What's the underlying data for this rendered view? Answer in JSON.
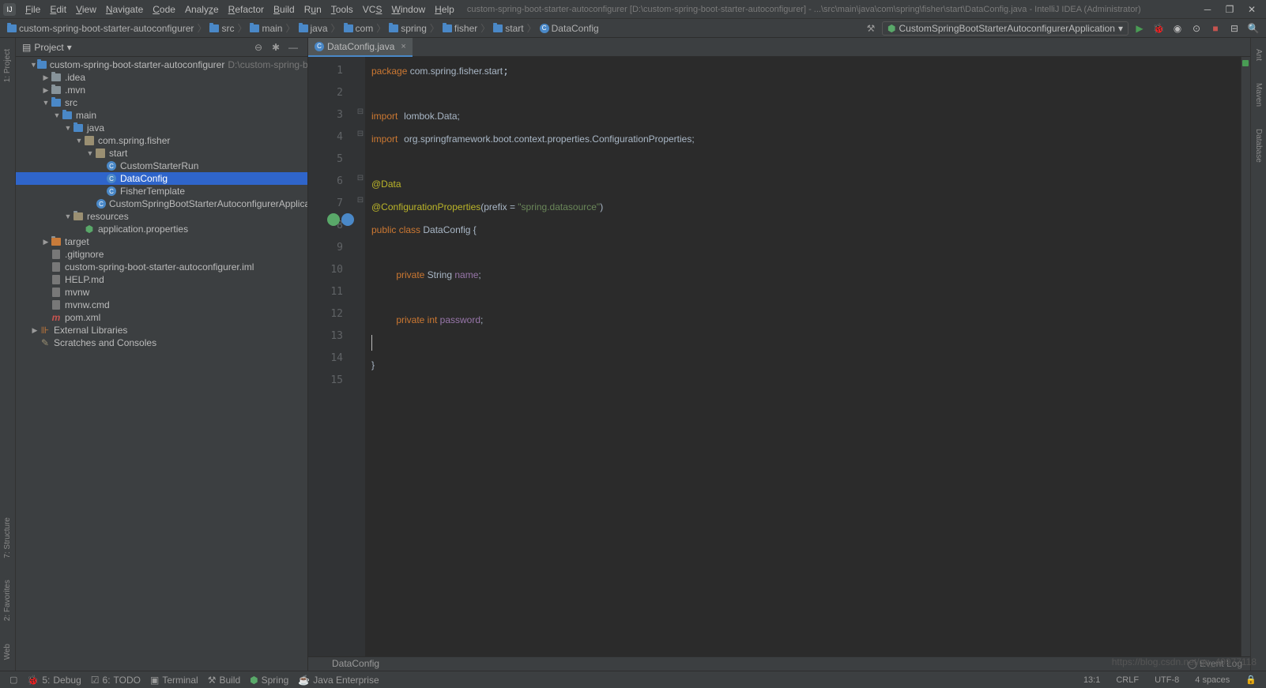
{
  "window": {
    "title": "custom-spring-boot-starter-autoconfigurer [D:\\custom-spring-boot-starter-autoconfigurer] - ...\\src\\main\\java\\com\\spring\\fisher\\start\\DataConfig.java - IntelliJ IDEA (Administrator)"
  },
  "menu": [
    "File",
    "Edit",
    "View",
    "Navigate",
    "Code",
    "Analyze",
    "Refactor",
    "Build",
    "Run",
    "Tools",
    "VCS",
    "Window",
    "Help"
  ],
  "breadcrumbs": [
    "custom-spring-boot-starter-autoconfigurer",
    "src",
    "main",
    "java",
    "com",
    "spring",
    "fisher",
    "start",
    "DataConfig"
  ],
  "run_config": {
    "selected": "CustomSpringBootStarterAutoconfigurerApplication"
  },
  "project_panel": {
    "title": "Project"
  },
  "tree": {
    "root": {
      "label": "custom-spring-boot-starter-autoconfigurer",
      "suffix": "D:\\custom-spring-boot-starte"
    },
    "items": [
      {
        "depth": 1,
        "arrow": "open",
        "icon": "module",
        "label": "custom-spring-boot-starter-autoconfigurer",
        "suffix": "D:\\custom-spring-boot-starte"
      },
      {
        "depth": 2,
        "arrow": "closed",
        "icon": "folder",
        "label": ".idea"
      },
      {
        "depth": 2,
        "arrow": "closed",
        "icon": "folder",
        "label": ".mvn"
      },
      {
        "depth": 2,
        "arrow": "open",
        "icon": "folder-blue",
        "label": "src"
      },
      {
        "depth": 3,
        "arrow": "open",
        "icon": "folder-blue",
        "label": "main"
      },
      {
        "depth": 4,
        "arrow": "open",
        "icon": "folder-blue",
        "label": "java"
      },
      {
        "depth": 5,
        "arrow": "open",
        "icon": "package",
        "label": "com.spring.fisher"
      },
      {
        "depth": 6,
        "arrow": "open",
        "icon": "package",
        "label": "start"
      },
      {
        "depth": 7,
        "arrow": "leaf",
        "icon": "class",
        "label": "CustomStarterRun"
      },
      {
        "depth": 7,
        "arrow": "leaf",
        "icon": "class",
        "label": "DataConfig",
        "selected": true
      },
      {
        "depth": 7,
        "arrow": "leaf",
        "icon": "class",
        "label": "FisherTemplate"
      },
      {
        "depth": 7,
        "arrow": "leaf",
        "icon": "class-run",
        "label": "CustomSpringBootStarterAutoconfigurerApplication"
      },
      {
        "depth": 4,
        "arrow": "open",
        "icon": "resources",
        "label": "resources"
      },
      {
        "depth": 5,
        "arrow": "leaf",
        "icon": "props",
        "label": "application.properties"
      },
      {
        "depth": 2,
        "arrow": "closed",
        "icon": "folder-orange",
        "label": "target"
      },
      {
        "depth": 2,
        "arrow": "leaf",
        "icon": "file",
        "label": ".gitignore"
      },
      {
        "depth": 2,
        "arrow": "leaf",
        "icon": "file",
        "label": "custom-spring-boot-starter-autoconfigurer.iml"
      },
      {
        "depth": 2,
        "arrow": "leaf",
        "icon": "file",
        "label": "HELP.md"
      },
      {
        "depth": 2,
        "arrow": "leaf",
        "icon": "file",
        "label": "mvnw"
      },
      {
        "depth": 2,
        "arrow": "leaf",
        "icon": "file",
        "label": "mvnw.cmd"
      },
      {
        "depth": 2,
        "arrow": "leaf",
        "icon": "maven",
        "label": "pom.xml"
      },
      {
        "depth": 1,
        "arrow": "closed",
        "icon": "lib",
        "label": "External Libraries"
      },
      {
        "depth": 1,
        "arrow": "leaf",
        "icon": "scratch",
        "label": "Scratches and Consoles"
      }
    ]
  },
  "tab": {
    "label": "DataConfig.java"
  },
  "code": {
    "l1": "package com.spring.fisher.start;",
    "l3a": "import",
    "l3b": "lombok.Data;",
    "l4a": "import",
    "l4b": "org.springframework.boot.context.properties.ConfigurationProperties;",
    "l6": "@Data",
    "l7a": "@ConfigurationProperties",
    "l7b": "(prefix = ",
    "l7c": "\"spring.datasource\"",
    "l7d": ")",
    "l8a": "public class ",
    "l8b": "DataConfig",
    "l8c": " {",
    "l10a": "private ",
    "l10b": "String ",
    "l10c": "name",
    "l10d": ";",
    "l12a": "private int ",
    "l12b": "password",
    "l12c": ";",
    "l14": "}"
  },
  "editor_footer": "DataConfig",
  "status": {
    "left": [
      "Debug",
      "TODO",
      "Terminal",
      "Build",
      "Spring",
      "Java Enterprise"
    ],
    "numbers_prefix": [
      "5:",
      "6:",
      "",
      "",
      "",
      ""
    ],
    "right": [
      "13:1",
      "CRLF",
      "UTF-8",
      "4 spaces"
    ],
    "eventlog": "Event Log"
  },
  "left_tools": [
    "1: Project",
    "7: Structure",
    "2: Favorites",
    "Web"
  ],
  "right_tools": [
    "Ant",
    "Maven",
    "Database"
  ],
  "watermark": "https://blog.csdn.net/qq_40977118"
}
